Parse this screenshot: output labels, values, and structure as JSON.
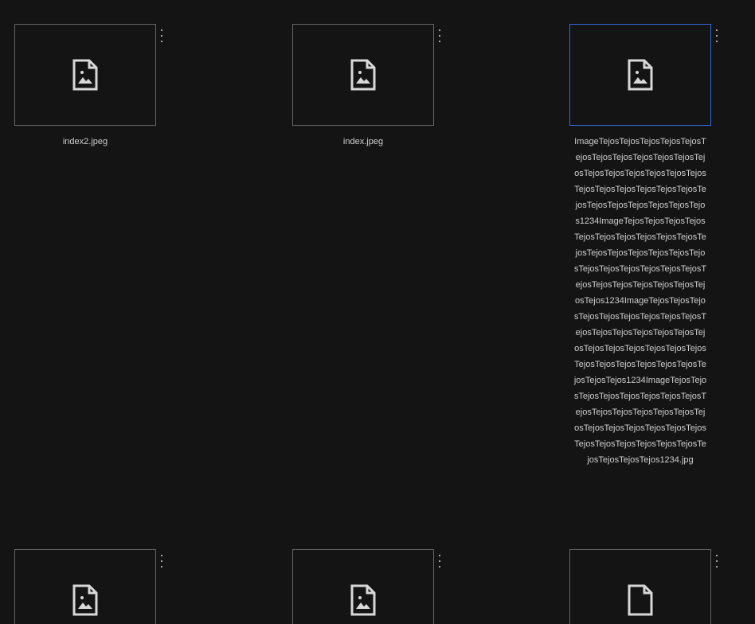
{
  "files": [
    {
      "name": "index2.jpeg",
      "icon": "image-file-icon"
    },
    {
      "name": "index.jpeg",
      "icon": "image-file-icon"
    },
    {
      "name": "ImageTejosTejosTejosTejosTejosTejosTejosTejosTejosTejosTejosTejosTejosTejosTejosTejosTejosTejosTejosTejosTejosTejosTejosTejosTejosTejosTejosTejosTejosTejosTejos1234ImageTejosTejosTejosTejosTejosTejosTejosTejosTejosTejosTejosTejosTejosTejosTejosTejosTejosTejosTejosTejosTejosTejosTejosTejosTejosTejosTejosTejosTejosTejosTejos1234ImageTejosTejosTejosTejosTejosTejosTejosTejosTejosTejosTejosTejosTejosTejosTejosTejosTejosTejosTejosTejosTejosTejosTejosTejosTejosTejosTejosTejosTejosTejosTejos1234ImageTejosTejosTejosTejosTejosTejosTejosTejosTejosTejosTejosTejosTejosTejosTejosTejosTejosTejosTejosTejosTejosTejosTejosTejosTejosTejosTejosTejosTejosTejosTejos1234.jpg",
      "icon": "image-file-icon",
      "selected": true
    },
    {
      "name": "",
      "icon": "image-file-icon"
    },
    {
      "name": "",
      "icon": "image-file-icon"
    },
    {
      "name": "",
      "icon": "generic-file-icon"
    }
  ],
  "colors": {
    "background": "#141414",
    "border": "#666666",
    "selected_border": "#2f6bd8",
    "text": "#cfcfcf",
    "icon": "#d8d8d8"
  }
}
